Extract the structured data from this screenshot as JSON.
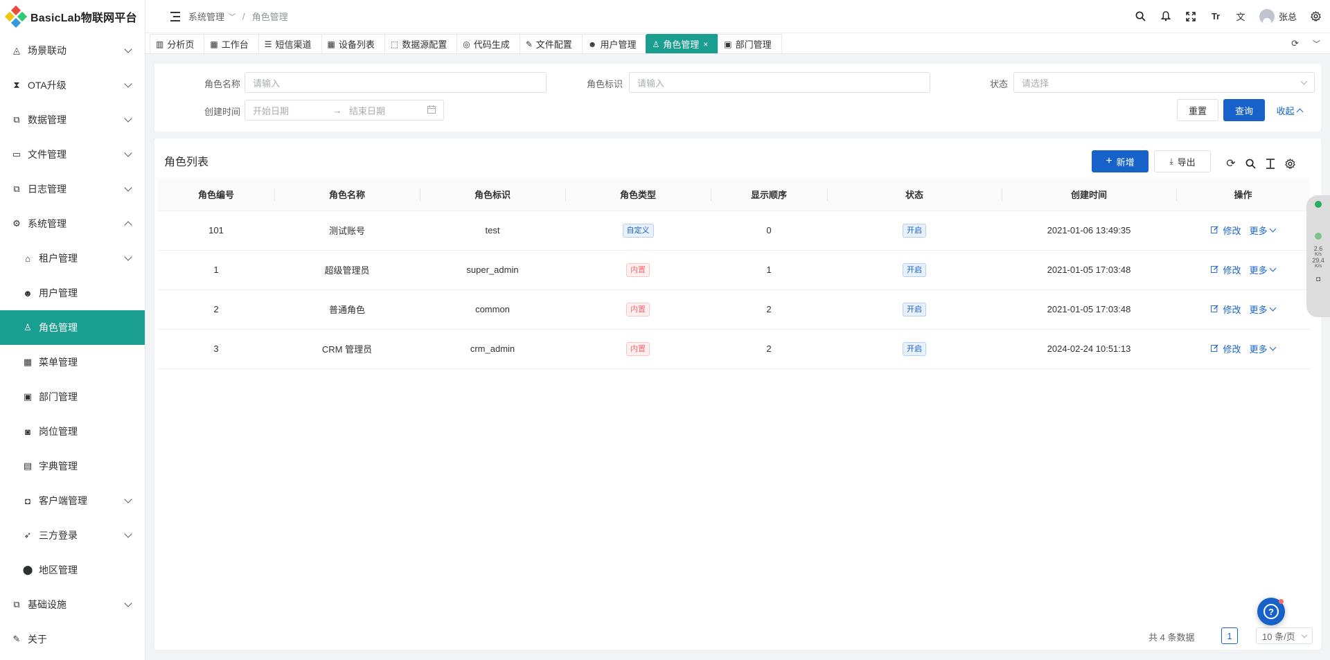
{
  "app": {
    "title": "BasicLab物联网平台"
  },
  "sidebar": {
    "items": [
      {
        "label": "场景联动",
        "icon": "triangle-icon",
        "glyph": "◬",
        "expandable": true
      },
      {
        "label": "OTA升级",
        "icon": "hourglass-icon",
        "glyph": "⧗",
        "expandable": true
      },
      {
        "label": "数据管理",
        "icon": "copy-icon",
        "glyph": "⧉",
        "expandable": true
      },
      {
        "label": "文件管理",
        "icon": "folder-icon",
        "glyph": "▭",
        "expandable": true
      },
      {
        "label": "日志管理",
        "icon": "copy-icon",
        "glyph": "⧉",
        "expandable": true
      },
      {
        "label": "系统管理",
        "icon": "gear-icon",
        "glyph": "⚙",
        "expandable": true,
        "open": true
      },
      {
        "label": "租户管理",
        "icon": "house-user-icon",
        "glyph": "⌂",
        "expandable": true,
        "sub": true
      },
      {
        "label": "用户管理",
        "icon": "user-icon",
        "glyph": "☻",
        "sub": true
      },
      {
        "label": "角色管理",
        "icon": "user-outline-icon",
        "glyph": "♙",
        "sub": true,
        "active": true
      },
      {
        "label": "菜单管理",
        "icon": "grid-icon",
        "glyph": "▦",
        "sub": true
      },
      {
        "label": "部门管理",
        "icon": "id-card-icon",
        "glyph": "▣",
        "sub": true
      },
      {
        "label": "岗位管理",
        "icon": "badge-icon",
        "glyph": "◙",
        "sub": true
      },
      {
        "label": "字典管理",
        "icon": "book-icon",
        "glyph": "▤",
        "sub": true
      },
      {
        "label": "客户端管理",
        "icon": "client-icon",
        "glyph": "◘",
        "expandable": true,
        "sub": true
      },
      {
        "label": "三方登录",
        "icon": "rocket-icon",
        "glyph": "➶",
        "expandable": true,
        "sub": true
      },
      {
        "label": "地区管理",
        "icon": "location-icon",
        "glyph": "⬤",
        "sub": true
      },
      {
        "label": "基础设施",
        "icon": "infra-icon",
        "glyph": "⧉",
        "expandable": true
      },
      {
        "label": "关于",
        "icon": "pin-icon",
        "glyph": "✎"
      }
    ]
  },
  "header": {
    "breadcrumb": [
      "系统管理",
      "角色管理"
    ],
    "user": "张总",
    "icons": [
      "search-icon",
      "bell-icon",
      "fullscreen-icon",
      "font-size-icon",
      "translate-icon"
    ]
  },
  "tabs": [
    {
      "label": "分析页",
      "glyph": "▥"
    },
    {
      "label": "工作台",
      "glyph": "▦"
    },
    {
      "label": "短信渠道",
      "glyph": "☰"
    },
    {
      "label": "设备列表",
      "glyph": "▦"
    },
    {
      "label": "数据源配置",
      "glyph": "⬚"
    },
    {
      "label": "代码生成",
      "glyph": "◎"
    },
    {
      "label": "文件配置",
      "glyph": "✎"
    },
    {
      "label": "用户管理",
      "glyph": "☻"
    },
    {
      "label": "角色管理",
      "glyph": "♙",
      "active": true,
      "close": "×"
    },
    {
      "label": "部门管理",
      "glyph": "▣"
    }
  ],
  "search": {
    "role_name_label": "角色名称",
    "role_name_placeholder": "请输入",
    "role_key_label": "角色标识",
    "role_key_placeholder": "请输入",
    "status_label": "状态",
    "status_placeholder": "请选择",
    "created_label": "创建时间",
    "start_placeholder": "开始日期",
    "range_sep": "→",
    "end_placeholder": "结束日期",
    "reset": "重置",
    "query": "查询",
    "collapse": "收起"
  },
  "list": {
    "title": "角色列表",
    "add": "新增",
    "export": "导出",
    "columns": [
      "角色编号",
      "角色名称",
      "角色标识",
      "角色类型",
      "显示顺序",
      "状态",
      "创建时间",
      "操作"
    ],
    "rows": [
      {
        "id": "101",
        "name": "测试账号",
        "key": "test",
        "type": "自定义",
        "type_color": "blue",
        "sort": "0",
        "status": "开启",
        "created": "2021-01-06 13:49:35"
      },
      {
        "id": "1",
        "name": "超级管理员",
        "key": "super_admin",
        "type": "内置",
        "type_color": "red",
        "sort": "1",
        "status": "开启",
        "created": "2021-01-05 17:03:48"
      },
      {
        "id": "2",
        "name": "普通角色",
        "key": "common",
        "type": "内置",
        "type_color": "red",
        "sort": "2",
        "status": "开启",
        "created": "2021-01-05 17:03:48"
      },
      {
        "id": "3",
        "name": "CRM 管理员",
        "key": "crm_admin",
        "type": "内置",
        "type_color": "red",
        "sort": "2",
        "status": "开启",
        "created": "2024-02-24 10:51:13"
      }
    ],
    "edit": "修改",
    "more": "更多"
  },
  "pagination": {
    "total": "共 4 条数据",
    "page": "1",
    "size": "10 条/页"
  },
  "net_widget": {
    "up": "2.6",
    "down": "29.4",
    "unit": "K/s"
  },
  "help": "?",
  "colors": {
    "primary": "#1762c9",
    "active_menu": "#1a9e8f"
  }
}
